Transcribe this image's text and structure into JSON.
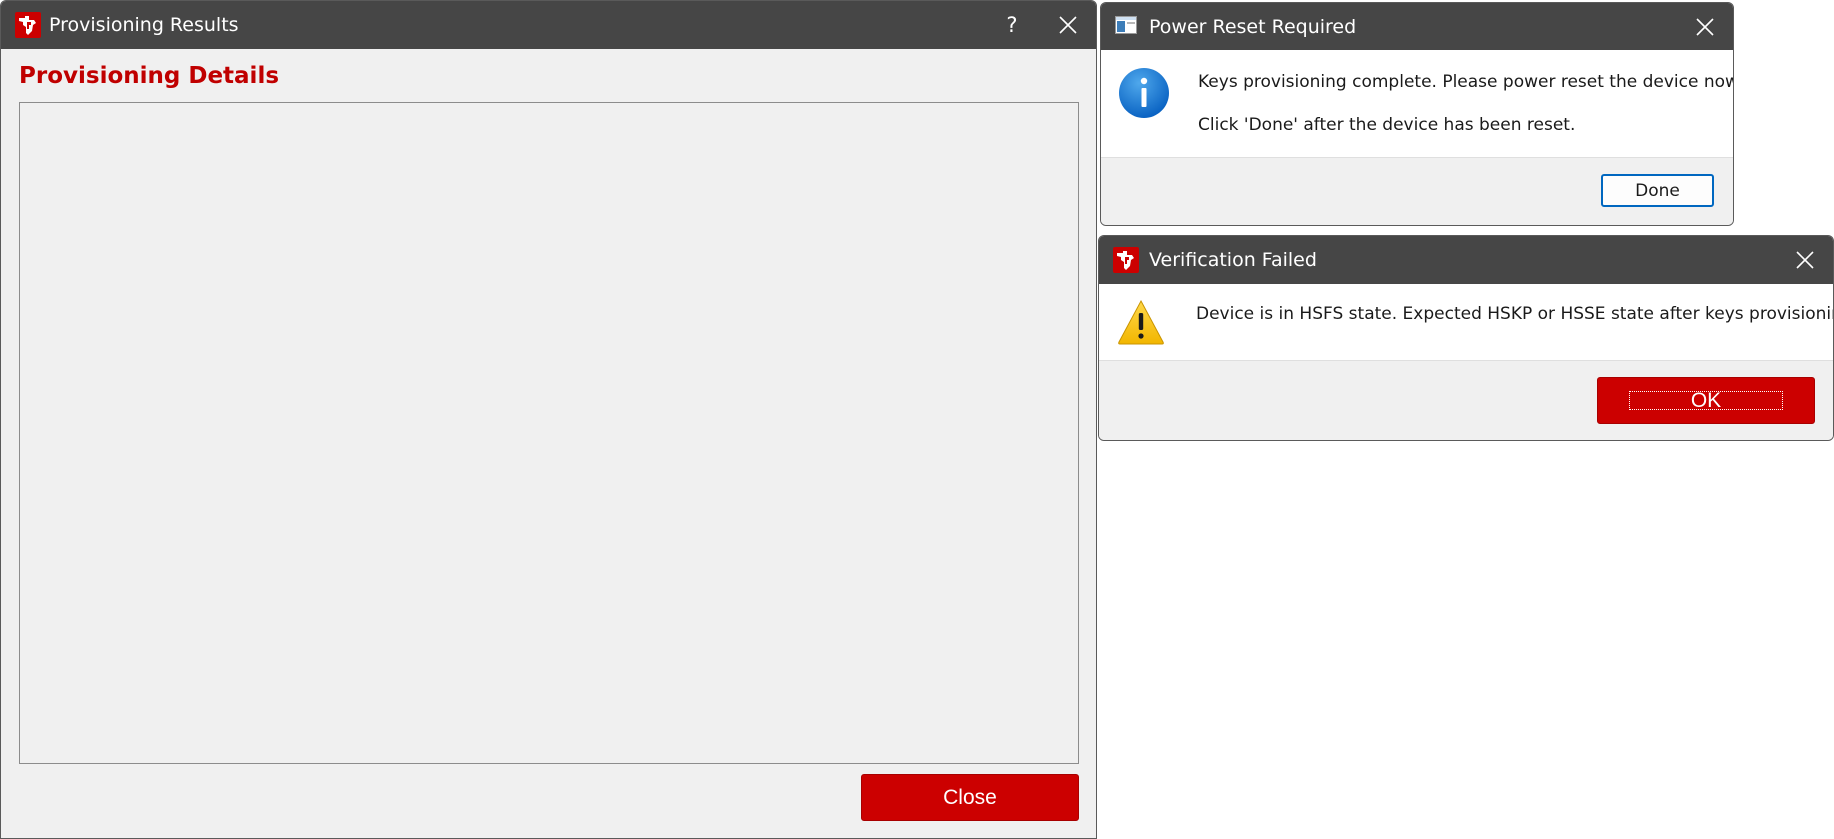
{
  "main_window": {
    "title": "Provisioning Results",
    "help_label": "?",
    "heading": "Provisioning Details",
    "close_button_label": "Close"
  },
  "power_reset_dialog": {
    "title": "Power Reset Required",
    "message_line1": "Keys provisioning complete. Please power reset the device now.",
    "message_line2": "Click 'Done' after the device has been reset.",
    "done_button_label": "Done",
    "icon": "info-icon"
  },
  "verification_dialog": {
    "title": "Verification Failed",
    "message": "Device is in HSFS state. Expected HSKP or HSSE state after keys provisioning.",
    "ok_button_label": "OK",
    "icon": "warning-icon"
  },
  "colors": {
    "titlebar": "#464646",
    "accent_red": "#cc0000",
    "heading_red": "#c00000",
    "focus_blue": "#0067c0"
  }
}
